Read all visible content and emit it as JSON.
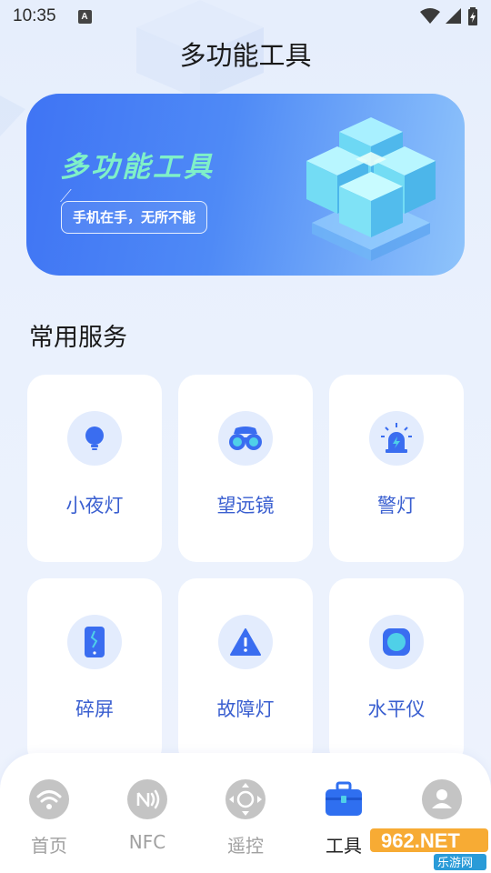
{
  "status_bar": {
    "time": "10:35",
    "notification_letter": "A",
    "icons": [
      "wifi-icon",
      "signal-icon",
      "battery-charging-icon"
    ]
  },
  "header": {
    "title": "多功能工具"
  },
  "banner": {
    "title": "多功能工具",
    "tagline": "手机在手，无所不能",
    "title_color": "#7ff0c8",
    "gradient": [
      "#3f74f4",
      "#8fc4fb"
    ]
  },
  "services": {
    "section_title": "常用服务",
    "items": [
      {
        "label": "小夜灯",
        "icon": "night-light-bulb-icon"
      },
      {
        "label": "望远镜",
        "icon": "binoculars-icon"
      },
      {
        "label": "警灯",
        "icon": "alarm-siren-icon"
      },
      {
        "label": "碎屏",
        "icon": "cracked-phone-icon"
      },
      {
        "label": "故障灯",
        "icon": "warning-triangle-icon"
      },
      {
        "label": "水平仪",
        "icon": "level-bubble-icon"
      }
    ]
  },
  "tabbar": {
    "items": [
      {
        "label": "首页",
        "icon": "wifi-icon",
        "active": false
      },
      {
        "label": "NFC",
        "icon": "nfc-icon",
        "active": false
      },
      {
        "label": "遥控",
        "icon": "remote-dpad-icon",
        "active": false
      },
      {
        "label": "工具",
        "icon": "toolbox-icon",
        "active": true
      },
      {
        "label": "",
        "icon": "user-icon",
        "active": false
      }
    ]
  },
  "watermark": {
    "text_top": "962.NET",
    "text_bottom": "乐游网"
  },
  "colors": {
    "accent": "#3a6df0",
    "icon_bg": "#e3ecfd",
    "label_blue": "#3a5fd0",
    "tab_inactive": "#c4c4c4"
  }
}
